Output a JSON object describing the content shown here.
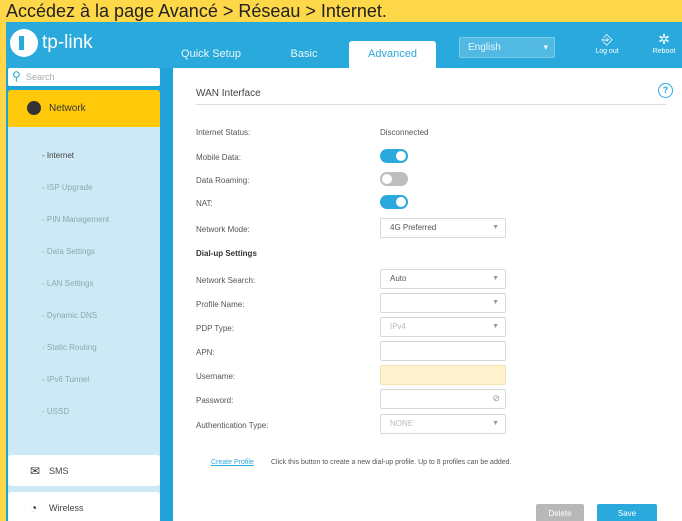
{
  "caption": "Accédez à la page Avancé > Réseau > Internet.",
  "brand": {
    "name": "tp-link"
  },
  "topnav": {
    "tabs": [
      {
        "label": "Quick Setup"
      },
      {
        "label": "Basic"
      },
      {
        "label": "Advanced"
      }
    ],
    "language": "English",
    "logout_label": "Log out",
    "reboot_label": "Reboot"
  },
  "sidebar": {
    "search_placeholder": "Search",
    "network_label": "Network",
    "subitems": [
      {
        "label": "- Internet"
      },
      {
        "label": "- ISP Upgrade"
      },
      {
        "label": "- PIN Management"
      },
      {
        "label": "- Data Settings"
      },
      {
        "label": "- LAN Settings"
      },
      {
        "label": "- Dynamic DNS"
      },
      {
        "label": "- Static Routing"
      },
      {
        "label": "- IPv6 Tunnel"
      },
      {
        "label": "- USSD"
      }
    ],
    "sms_label": "SMS",
    "wireless_label": "Wireless"
  },
  "main": {
    "section_title": "WAN Interface",
    "internet_status_label": "Internet Status:",
    "internet_status_value": "Disconnected",
    "mobile_data_label": "Mobile Data:",
    "mobile_data_on": true,
    "data_roaming_label": "Data Roaming:",
    "data_roaming_on": false,
    "nat_label": "NAT:",
    "nat_on": true,
    "network_mode_label": "Network Mode:",
    "network_mode_value": "4G Preferred",
    "dialup_title": "Dial-up Settings",
    "network_search_label": "Network Search:",
    "network_search_value": "Auto",
    "profile_name_label": "Profile Name:",
    "profile_name_value": "",
    "pdp_type_label": "PDP Type:",
    "pdp_type_value": "IPv4",
    "apn_label": "APN:",
    "username_label": "Username:",
    "password_label": "Password:",
    "auth_type_label": "Authentication Type:",
    "auth_type_value": "NONE",
    "create_profile_link": "Create Profile",
    "create_profile_hint": "Click this button to create a new dial-up profile. Up to 8 profiles can be added.",
    "delete_label": "Delete",
    "save_label": "Save"
  },
  "colors": {
    "brand_blue": "#2aa9dc",
    "highlight_yellow": "#ffc90a",
    "caption_yellow": "#ffd84a"
  }
}
